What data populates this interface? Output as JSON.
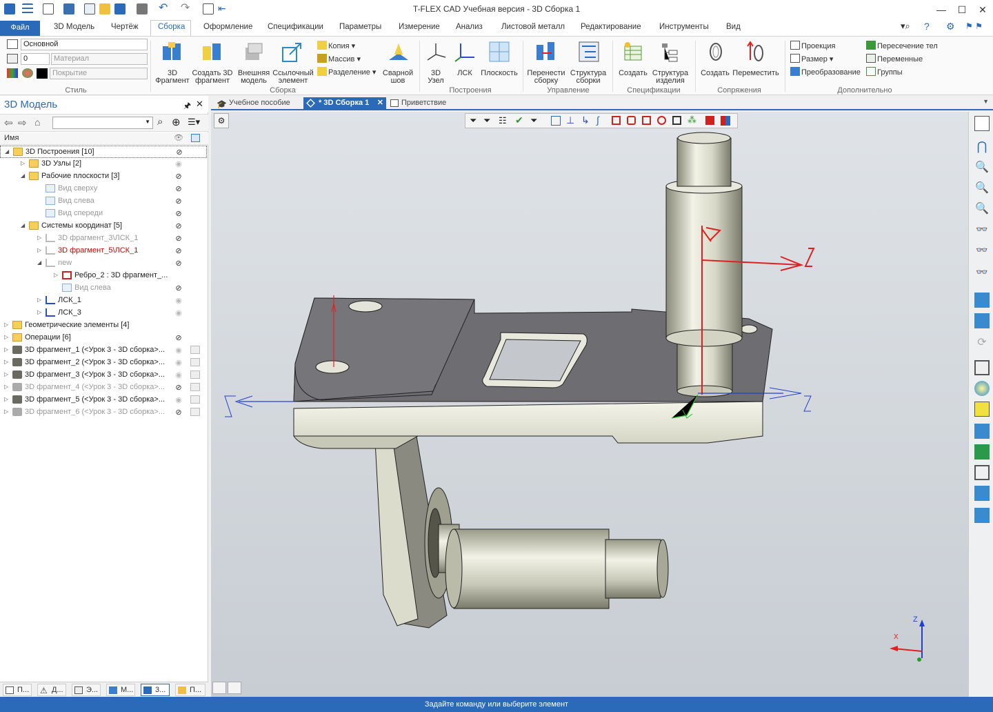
{
  "app": {
    "title": "T-FLEX CAD Учебная версия - 3D Сборка 1"
  },
  "menu_tabs": [
    "Файл",
    "3D Модель",
    "Чертёж",
    "Сборка",
    "Оформление",
    "Спецификации",
    "Параметры",
    "Измерение",
    "Анализ",
    "Листовой металл",
    "Редактирование",
    "Инструменты",
    "Вид"
  ],
  "ribbon": {
    "style": {
      "layer": "Основной",
      "material_placeholder": "Материал",
      "level": "0",
      "coating_placeholder": "Покрытие",
      "group": "Стиль"
    },
    "assembly": {
      "fragment3d": "3D\nФрагмент",
      "create_fragment": "Создать 3D\nфрагмент",
      "external_model": "Внешняя\nмодель",
      "reference_element": "Ссылочный\nэлемент",
      "copy": "Копия",
      "array": "Массив",
      "split": "Разделение",
      "weld": "Сварной\nшов",
      "group": "Сборка"
    },
    "constructions": {
      "node3d": "3D\nУзел",
      "lsk": "ЛСК",
      "plane": "Плоскость",
      "group": "Построения"
    },
    "control": {
      "rebuild": "Перенести\nсборку",
      "structure": "Структура\nсборки",
      "group": "Управление"
    },
    "specs": {
      "create": "Создать",
      "product_structure": "Структура\nизделия",
      "group": "Спецификации"
    },
    "mates": {
      "create": "Создать",
      "move": "Переместить",
      "group": "Сопряжения"
    },
    "extra": {
      "projection": "Проекция",
      "size": "Размер",
      "transform": "Преобразование",
      "intersection": "Пересечение тел",
      "variables": "Переменные",
      "groups": "Группы",
      "group": "Дополнительно"
    }
  },
  "left_panel": {
    "title": "3D Модель",
    "column_name": "Имя",
    "tree": [
      {
        "label": "3D Построения [10]",
        "indent": 0,
        "expand": "▲",
        "icon": "folder",
        "style": "",
        "eye": "hidden"
      },
      {
        "label": "3D Узлы [2]",
        "indent": 1,
        "expand": "▷",
        "icon": "folder",
        "style": "",
        "eye": "visible"
      },
      {
        "label": "Рабочие плоскости [3]",
        "indent": 1,
        "expand": "▲",
        "icon": "folder",
        "style": "",
        "eye": "hidden"
      },
      {
        "label": "Вид сверху",
        "indent": 2,
        "expand": "",
        "icon": "plane",
        "style": "gray",
        "eye": "hidden"
      },
      {
        "label": "Вид слева",
        "indent": 2,
        "expand": "",
        "icon": "plane",
        "style": "gray",
        "eye": "hidden"
      },
      {
        "label": "Вид спереди",
        "indent": 2,
        "expand": "",
        "icon": "plane",
        "style": "gray",
        "eye": "hidden"
      },
      {
        "label": "Системы координат [5]",
        "indent": 1,
        "expand": "▲",
        "icon": "folder",
        "style": "",
        "eye": "hidden"
      },
      {
        "label": "3D фрагмент_3\\ЛСК_1",
        "indent": 2,
        "expand": "▷",
        "icon": "lsk-gray",
        "style": "gray",
        "eye": "hidden"
      },
      {
        "label": "3D фрагмент_5\\ЛСК_1",
        "indent": 2,
        "expand": "▷",
        "icon": "lsk-gray",
        "style": "red",
        "eye": "hidden"
      },
      {
        "label": "new",
        "indent": 2,
        "expand": "▲",
        "icon": "lsk-gray",
        "style": "gray",
        "eye": "hidden"
      },
      {
        "label": "Ребро_2 : 3D фрагмент_...",
        "indent": 3,
        "expand": "▷",
        "icon": "edge",
        "style": "",
        "eye": ""
      },
      {
        "label": "Вид слева",
        "indent": 3,
        "expand": "",
        "icon": "plane",
        "style": "gray",
        "eye": "hidden"
      },
      {
        "label": "ЛСК_1",
        "indent": 2,
        "expand": "▷",
        "icon": "lsk",
        "style": "",
        "eye": "visible"
      },
      {
        "label": "ЛСК_3",
        "indent": 2,
        "expand": "▷",
        "icon": "lsk",
        "style": "",
        "eye": "visible"
      },
      {
        "label": "Геометрические элементы [4]",
        "indent": 0,
        "expand": "▷",
        "icon": "folder",
        "style": "",
        "eye": ""
      },
      {
        "label": "Операции [6]",
        "indent": 0,
        "expand": "▷",
        "icon": "folder",
        "style": "",
        "eye": "hidden"
      },
      {
        "label": "3D фрагмент_1 (<Урок 3 - 3D сборка>...",
        "indent": 0,
        "expand": "▷",
        "icon": "frag",
        "style": "",
        "eye": "visible",
        "box": true
      },
      {
        "label": "3D фрагмент_2 (<Урок 3 - 3D сборка>...",
        "indent": 0,
        "expand": "▷",
        "icon": "frag",
        "style": "",
        "eye": "visible",
        "box": true
      },
      {
        "label": "3D фрагмент_3 (<Урок 3 - 3D сборка>...",
        "indent": 0,
        "expand": "▷",
        "icon": "frag",
        "style": "",
        "eye": "visible",
        "box": true
      },
      {
        "label": "3D фрагмент_4 (<Урок 3 - 3D сборка>...",
        "indent": 0,
        "expand": "▷",
        "icon": "frag",
        "style": "gray",
        "eye": "hidden",
        "box": true
      },
      {
        "label": "3D фрагмент_5 (<Урок 3 - 3D сборка>...",
        "indent": 0,
        "expand": "▷",
        "icon": "frag",
        "style": "",
        "eye": "visible",
        "box": true
      },
      {
        "label": "3D фрагмент_6 (<Урок 3 - 3D сборка>...",
        "indent": 0,
        "expand": "▷",
        "icon": "frag",
        "style": "gray",
        "eye": "hidden",
        "box": true
      }
    ],
    "bottom_tabs": [
      "П...",
      "Д...",
      "Э...",
      "М...",
      "3...",
      "П..."
    ]
  },
  "doc_tabs": [
    "Учебное пособие",
    "* 3D Сборка 1",
    "Приветствие"
  ],
  "statusbar": "Задайте команду или выберите элемент",
  "triad": {
    "x": "X",
    "z": "Z"
  },
  "colors": {
    "accent": "#2a6ab8",
    "x_axis": "#e02020",
    "y_axis": "#20a020",
    "z_axis": "#2040d0"
  }
}
